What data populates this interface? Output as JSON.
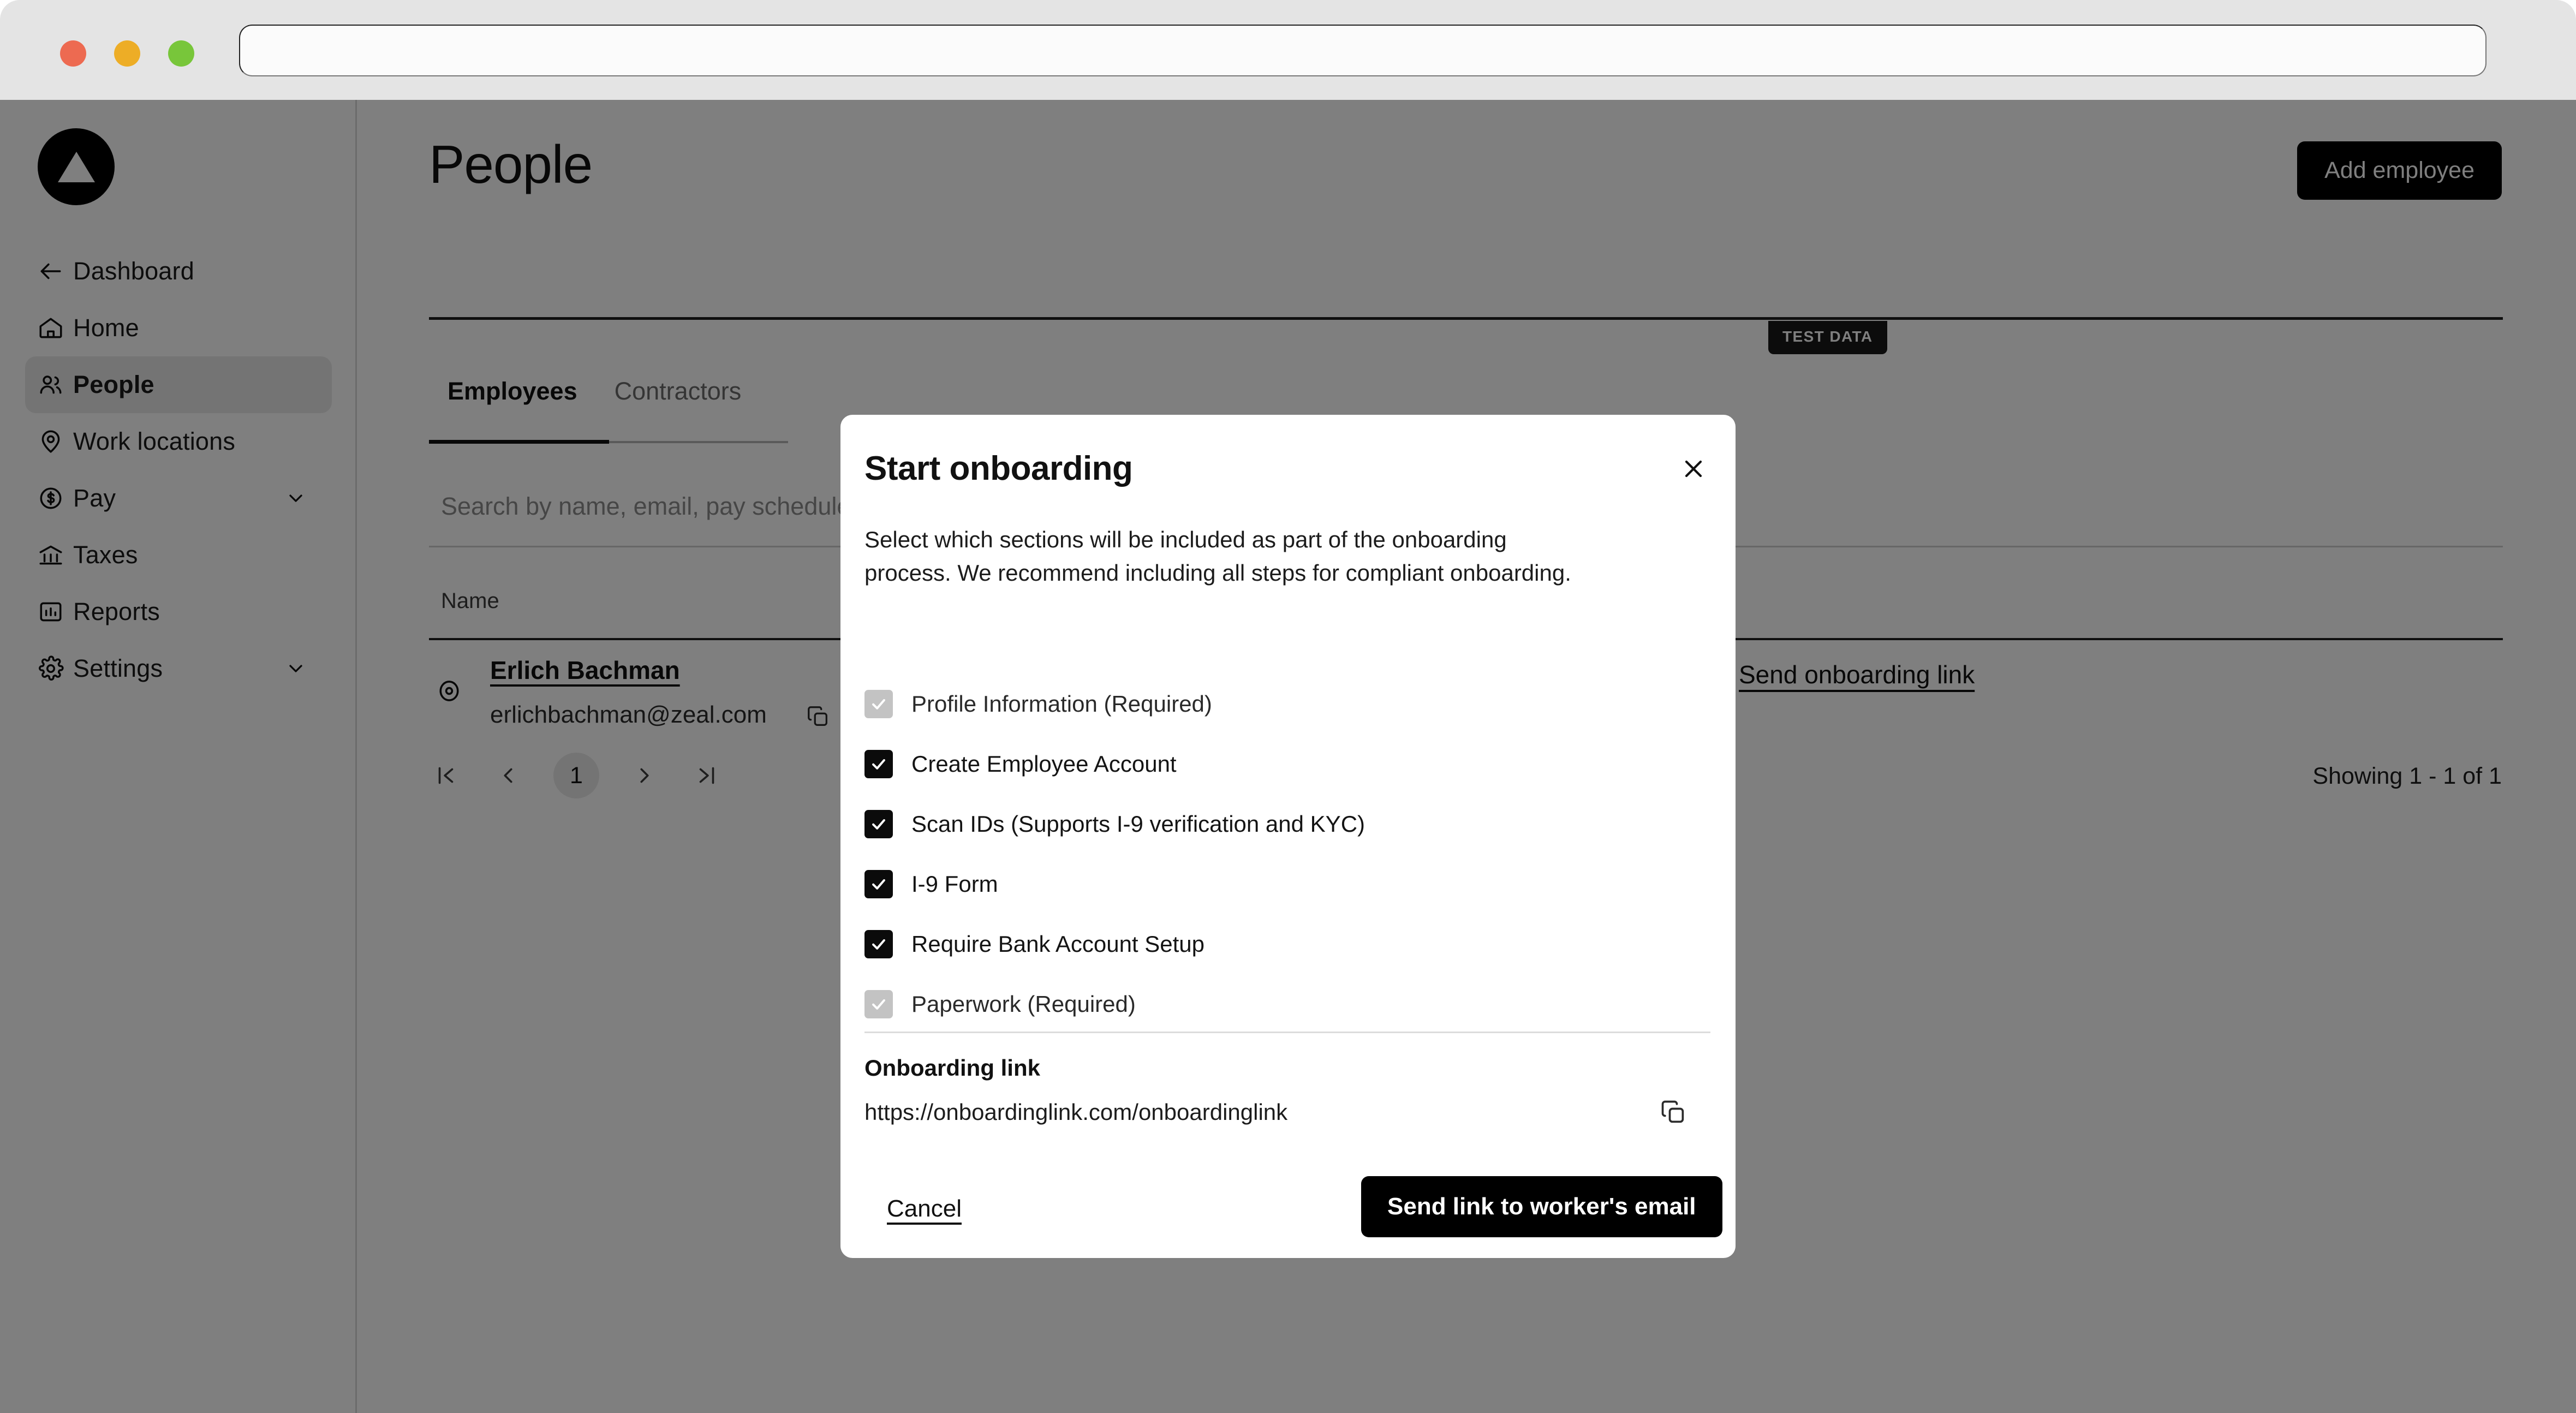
{
  "browser": {
    "url_value": "",
    "url_placeholder": ""
  },
  "sidebar": {
    "logo_icon": "triangle-logo",
    "items": [
      {
        "label": "Dashboard",
        "icon": "arrow-left-icon",
        "active": false,
        "chevron": false
      },
      {
        "label": "Home",
        "icon": "home-icon",
        "active": false,
        "chevron": false
      },
      {
        "label": "People",
        "icon": "people-icon",
        "active": true,
        "chevron": false
      },
      {
        "label": "Work locations",
        "icon": "location-pin-icon",
        "active": false,
        "chevron": false
      },
      {
        "label": "Pay",
        "icon": "dollar-coin-icon",
        "active": false,
        "chevron": true
      },
      {
        "label": "Taxes",
        "icon": "bank-icon",
        "active": false,
        "chevron": false
      },
      {
        "label": "Reports",
        "icon": "bar-chart-icon",
        "active": false,
        "chevron": false
      },
      {
        "label": "Settings",
        "icon": "gear-icon",
        "active": false,
        "chevron": true
      }
    ]
  },
  "main": {
    "page_title": "People",
    "add_employee_label": "Add employee",
    "test_data_badge": "TEST DATA",
    "tabs": [
      {
        "label": "Employees",
        "active": true
      },
      {
        "label": "Contractors",
        "active": false
      }
    ],
    "search": {
      "value": "",
      "placeholder": "Search by name, email, pay schedule, or onboarding status"
    },
    "table": {
      "columns": [
        "Name"
      ],
      "rows": [
        {
          "name": "Erlich Bachman",
          "email": "erlichbachman@zeal.com",
          "action_link": "Send onboarding link",
          "eye_icon": "eye-icon",
          "copy_icon": "copy-icon"
        }
      ]
    },
    "pagination": {
      "first_icon": "first-page-icon",
      "prev_icon": "prev-page-icon",
      "current_page": "1",
      "next_icon": "next-page-icon",
      "last_icon": "last-page-icon"
    },
    "showing_text": "Showing 1 - 1 of 1"
  },
  "modal": {
    "title": "Start onboarding",
    "close_icon": "close-icon",
    "description": "Select which sections will be included as part of the onboarding process. We recommend including all steps for compliant onboarding.",
    "checkboxes": [
      {
        "label": "Profile Information (Required)",
        "checked": true,
        "disabled": true
      },
      {
        "label": "Create Employee Account",
        "checked": true,
        "disabled": false
      },
      {
        "label": "Scan IDs (Supports I-9 verification and KYC)",
        "checked": true,
        "disabled": false
      },
      {
        "label": "I-9 Form",
        "checked": true,
        "disabled": false
      },
      {
        "label": "Require Bank Account Setup",
        "checked": true,
        "disabled": false
      },
      {
        "label": "Paperwork (Required)",
        "checked": true,
        "disabled": true
      }
    ],
    "onboarding_link_label": "Onboarding link",
    "onboarding_link_value": "https://onboardinglink.com/onboardinglink",
    "onboarding_link_copy_icon": "copy-icon",
    "cancel_label": "Cancel",
    "submit_label": "Send link to worker's email"
  },
  "colors": {
    "accent": "#000000",
    "overlay": "rgba(0,0,0,0.50)",
    "traffic_red": "#ed6a51",
    "traffic_yellow": "#edad26",
    "traffic_green": "#78c63a",
    "checkbox_on": "#0b0b0b",
    "checkbox_disabled": "#c3c3c3"
  }
}
